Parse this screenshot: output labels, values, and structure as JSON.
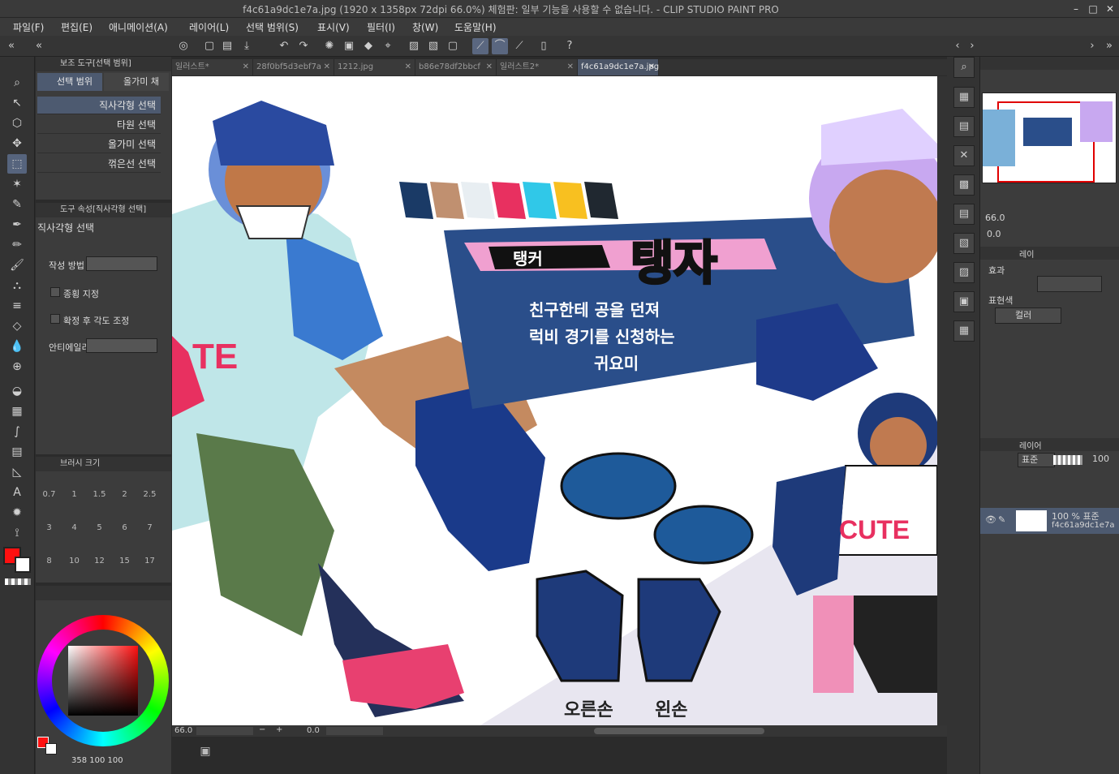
{
  "window": {
    "title": "f4c61a9dc1e7a.jpg (1920 x 1358px 72dpi 66.0%)  체험판: 일부 기능을 사용할 수 없습니다. - CLIP STUDIO PAINT PRO"
  },
  "menu": [
    "파일(F)",
    "편집(E)",
    "애니메이션(A)",
    "레이어(L)",
    "선택 범위(S)",
    "표시(V)",
    "필터(I)",
    "창(W)",
    "도움말(H)"
  ],
  "subtool": {
    "header": "보조 도구[선택 범위]",
    "tab_selection": "선택 범위",
    "tab_lasso": "올가미 채",
    "items": [
      "직사각형 선택",
      "타원 선택",
      "올가미 선택",
      "꺾은선 선택"
    ]
  },
  "toolprop": {
    "header": "도구 속성[직사각형 선택]",
    "name": "직사각형 선택",
    "create_method": "작성 방법",
    "aspect": "종횡 지정",
    "rotate": "확정 후 각도 조정",
    "antialias": "안티에일리"
  },
  "brushsize": {
    "header": "브러시 크기",
    "sizes": [
      "0.7",
      "1",
      "1.5",
      "2",
      "2.5",
      "3",
      "4",
      "5",
      "6",
      "7",
      "8",
      "10",
      "12",
      "15",
      "17"
    ]
  },
  "color": {
    "primary": "#ff1010",
    "secondary": "#ffffff",
    "readout": "358   100   100"
  },
  "tabs": [
    {
      "label": "일러스트*",
      "active": false
    },
    {
      "label": "28f0bf5d3ebf7a",
      "active": false
    },
    {
      "label": "1212.jpg",
      "active": false
    },
    {
      "label": "b86e78df2bbcf",
      "active": false
    },
    {
      "label": "일러스트2*",
      "active": false
    },
    {
      "label": "f4c61a9dc1e7a.jpg",
      "active": true
    }
  ],
  "artwork": {
    "tag": "탱커",
    "name": "탱자",
    "desc": [
      "친구한테 공을 던져",
      "럭비 경기를 신청하는",
      "귀요미"
    ],
    "right_hand": "오른손",
    "left_hand": "왼손",
    "shirt": "CUTE",
    "shirt_left": "TE",
    "palette": [
      "#1a3a66",
      "#c09070",
      "#e8eef2",
      "#e83060",
      "#30c8e8",
      "#f8c020",
      "#202830"
    ]
  },
  "status": {
    "zoom": "66.0",
    "angle": "0.0"
  },
  "navigator": {
    "zoom": "66.0",
    "angle": "0.0"
  },
  "layerprop": {
    "header": "레이",
    "effect": "효과",
    "expr_label": "표현색",
    "expr_value": "컬러"
  },
  "layers": {
    "header": "레이어",
    "blend": "표준",
    "opacity": "100",
    "layer_line1": "100 % 표준",
    "layer_line2": "f4c61a9dc1e7a"
  }
}
